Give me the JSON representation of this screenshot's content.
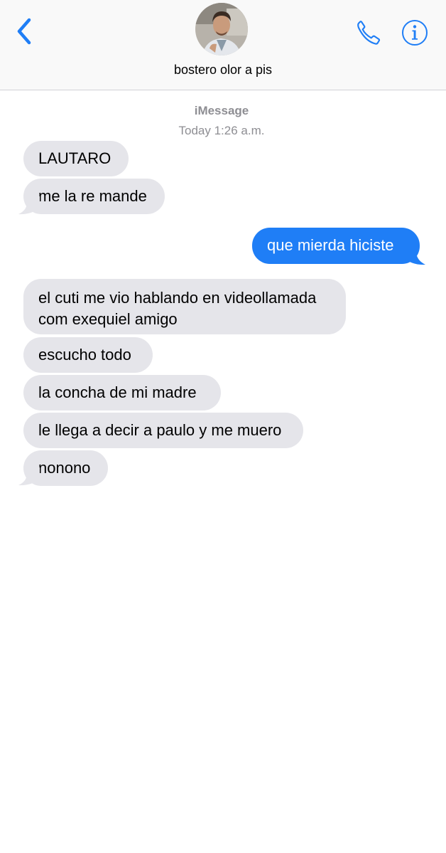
{
  "header": {
    "back_icon": "chevron-left-icon",
    "contact_name": "bostero olor a pis",
    "call_icon": "phone-icon",
    "info_icon": "info-icon"
  },
  "meta": {
    "service": "iMessage",
    "timestamp": "Today 1:26 a.m."
  },
  "messages": [
    {
      "direction": "incoming",
      "lines": [
        "LAUTARO"
      ]
    },
    {
      "direction": "incoming",
      "lines": [
        "me la re mande"
      ]
    },
    {
      "direction": "outgoing",
      "lines": [
        "que mierda hiciste"
      ]
    },
    {
      "direction": "incoming",
      "lines": [
        "el cuti me vio hablando en videollamada",
        "com exequiel amigo"
      ]
    },
    {
      "direction": "incoming",
      "lines": [
        "escucho todo"
      ]
    },
    {
      "direction": "incoming",
      "lines": [
        "la concha de mi madre"
      ]
    },
    {
      "direction": "incoming",
      "lines": [
        "le llega a decir a paulo y me muero"
      ]
    },
    {
      "direction": "incoming",
      "lines": [
        "nonono"
      ]
    }
  ],
  "colors": {
    "accent": "#1f7ef6",
    "incoming_bubble": "#e5e5ea",
    "secondary_text": "#8e8e93"
  }
}
